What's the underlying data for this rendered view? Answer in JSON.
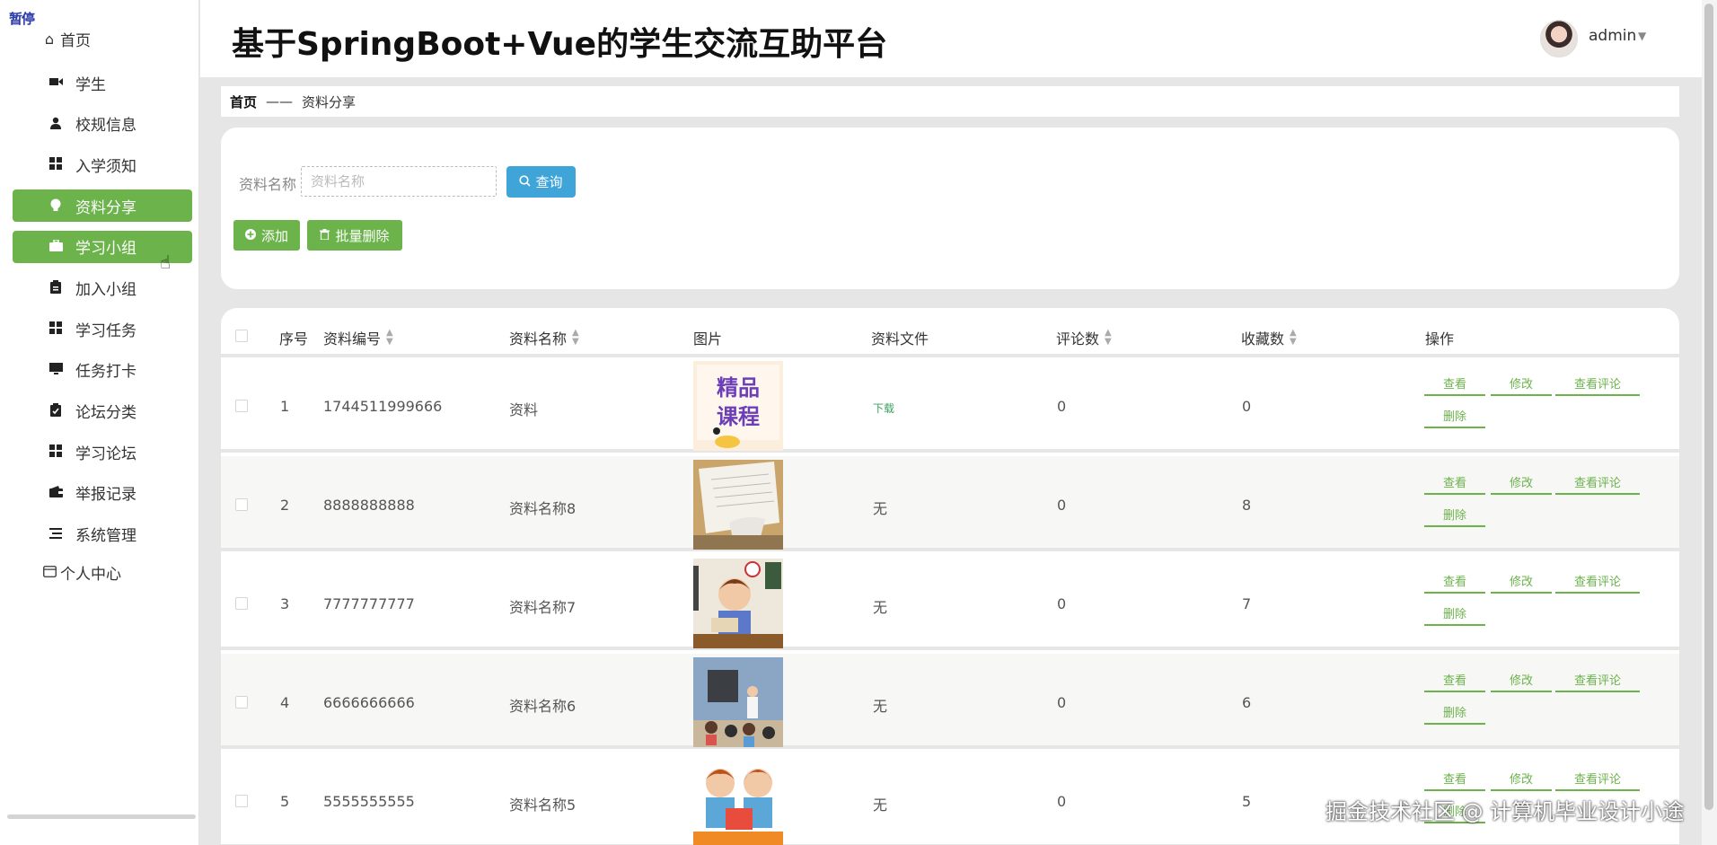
{
  "app": {
    "pause_tag": "暂停",
    "title": "基于SpringBoot+Vue的学生交流互助平台"
  },
  "sidebar": {
    "home_label": "首页",
    "items": [
      {
        "label": "学生",
        "icon": "video-camera-icon"
      },
      {
        "label": "校规信息",
        "icon": "user-icon"
      },
      {
        "label": "入学须知",
        "icon": "grid-icon"
      },
      {
        "label": "资料分享",
        "icon": "lightbulb-icon",
        "active": true
      },
      {
        "label": "学习小组",
        "icon": "briefcase-icon",
        "active": true
      },
      {
        "label": "加入小组",
        "icon": "clipboard-icon"
      },
      {
        "label": "学习任务",
        "icon": "grid-icon"
      },
      {
        "label": "任务打卡",
        "icon": "monitor-icon"
      },
      {
        "label": "论坛分类",
        "icon": "checklist-icon"
      },
      {
        "label": "学习论坛",
        "icon": "grid-icon"
      },
      {
        "label": "举报记录",
        "icon": "wallet-icon"
      },
      {
        "label": "系统管理",
        "icon": "list-icon"
      }
    ],
    "personal_label": "个人中心"
  },
  "user": {
    "name": "admin"
  },
  "breadcrumb": {
    "home": "首页",
    "separator": "——",
    "current": "资料分享"
  },
  "search": {
    "label": "资料名称",
    "value": "",
    "placeholder": "资料名称",
    "query_label": "查询"
  },
  "actions": {
    "add_label": "添加",
    "batch_delete_label": "批量删除"
  },
  "table": {
    "columns": [
      "序号",
      "资料编号",
      "资料名称",
      "图片",
      "资料文件",
      "评论数",
      "收藏数",
      "操作"
    ],
    "rows": [
      {
        "index": "1",
        "code": "1744511999666",
        "name": "资料",
        "file": "下载",
        "comments": "0",
        "favorites": "0",
        "thumb_text": [
          "精品",
          "课程"
        ]
      },
      {
        "index": "2",
        "code": "8888888888",
        "name": "资料名称8",
        "file": "无",
        "comments": "0",
        "favorites": "8"
      },
      {
        "index": "3",
        "code": "7777777777",
        "name": "资料名称7",
        "file": "无",
        "comments": "0",
        "favorites": "7"
      },
      {
        "index": "4",
        "code": "6666666666",
        "name": "资料名称6",
        "file": "无",
        "comments": "0",
        "favorites": "6"
      },
      {
        "index": "5",
        "code": "5555555555",
        "name": "资料名称5",
        "file": "无",
        "comments": "0",
        "favorites": "5"
      }
    ],
    "ops": {
      "view": "查看",
      "edit": "修改",
      "comments": "查看评论",
      "delete": "删除"
    }
  },
  "watermark": "掘金技术社区 @ 计算机毕业设计小途",
  "colors": {
    "accent_green": "#6bb34a",
    "query_blue": "#3fa4d8",
    "page_bg": "#e6e6e6"
  }
}
